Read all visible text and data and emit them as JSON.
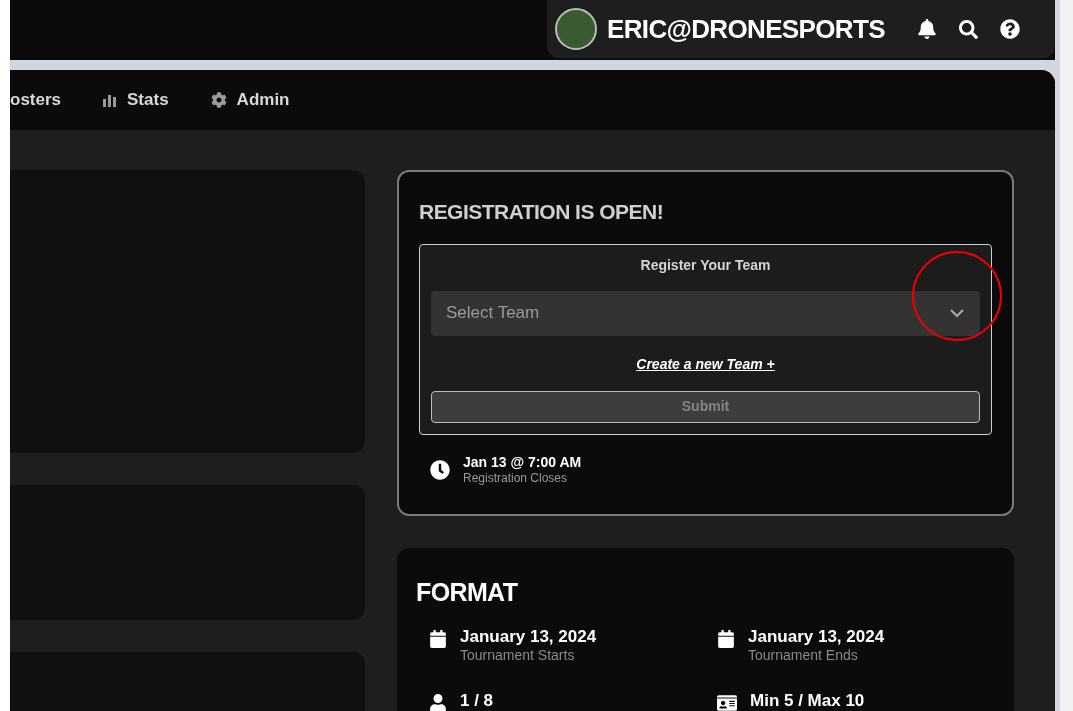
{
  "user": {
    "name": "ERIC@DRONESPORTS"
  },
  "nav": [
    {
      "label": "osters",
      "kind": "plain"
    },
    {
      "label": "Stats",
      "kind": "stats"
    },
    {
      "label": "Admin",
      "kind": "admin"
    }
  ],
  "registration": {
    "title": "REGISTRATION IS OPEN!",
    "form_title": "Register Your Team",
    "select": {
      "placeholder": "Select Team"
    },
    "create_link": "Create a new Team +",
    "submit": {
      "label": "Submit",
      "disabled": true
    },
    "deadline": {
      "value": "Jan 13 @ 7:00 AM",
      "label": "Registration Closes"
    }
  },
  "format": {
    "title": "FORMAT",
    "items": [
      {
        "kind": "date",
        "value": "January 13, 2024",
        "label": "Tournament Starts"
      },
      {
        "kind": "date",
        "value": "January 13, 2024",
        "label": "Tournament Ends"
      },
      {
        "kind": "teams",
        "value": "1 / 8"
      },
      {
        "kind": "roster",
        "value": "Min 5 / Max 10"
      }
    ]
  }
}
